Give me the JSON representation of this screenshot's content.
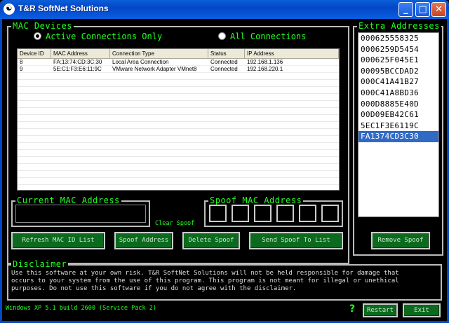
{
  "window": {
    "title": "T&R SoftNet Solutions",
    "icon": "app-logo-icon"
  },
  "window_controls": {
    "minimize": "_",
    "maximize": "□",
    "close": "✕"
  },
  "mac_devices": {
    "legend": "MAC Devices",
    "radio_active": "Active Connections Only",
    "radio_all": "All Connections",
    "selected": "active",
    "columns": [
      "Device ID",
      "MAC Address",
      "Connection Type",
      "Status",
      "IP Address"
    ],
    "rows": [
      [
        "8",
        "FA:13:74:CD:3C:30",
        "Local Area Connection",
        "Connected",
        "192.168.1.136"
      ],
      [
        "9",
        "5E:C1:F3:E6:11:9C",
        "VMware Network Adapter VMnet8",
        "Connected",
        "192.168.220.1"
      ]
    ]
  },
  "extra_addresses": {
    "legend": "Extra Addresses",
    "items": [
      "000625558325",
      "0006259D5454",
      "000625F045E1",
      "00095BCCDAD2",
      "000C41A41B27",
      "000C41A8BD36",
      "000D8885E40D",
      "00D09EB42C61",
      "5EC1F3E6119C",
      "FA1374CD3C30"
    ],
    "selected_index": 9
  },
  "current_mac": {
    "legend": "Current MAC Address",
    "value": ""
  },
  "spoof_mac": {
    "legend": "Spoof MAC Address",
    "boxes": [
      "",
      "",
      "",
      "",
      "",
      ""
    ]
  },
  "clear_spoof_label": "Clear Spoof",
  "buttons": {
    "refresh": "Refresh MAC ID List",
    "spoof": "Spoof Address",
    "delete": "Delete Spoof",
    "send": "Send Spoof To List",
    "remove": "Remove Spoof",
    "restart": "Restart",
    "exit": "Exit"
  },
  "disclaimer": {
    "legend": "Disclaimer",
    "lines": [
      "Use this software at your own risk.  T&R SoftNet Solutions will not be held responsible for damage that",
      "occurs to your system from the use of this program.  This program is not meant for illegal or unethical",
      "purposes.  Do not use this software if you do not agree with the disclaimer."
    ]
  },
  "status": "Windows XP 5.1 build 2600 (Service Pack 2)",
  "help_icon": "?"
}
